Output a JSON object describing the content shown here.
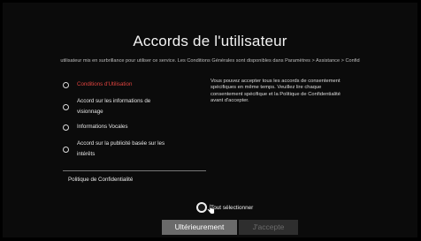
{
  "title": "Accords de l'utilisateur",
  "banner": "utilisateur mis en surbrillance pour utiliser ce service. Les Conditions Générales sont disponibles dans Paramètres > Assistance > Confid",
  "agreements": [
    {
      "lines": [
        "Conditions d'Utilisation"
      ],
      "active": true
    },
    {
      "lines": [
        "Accord sur les informations de",
        "visionnage"
      ],
      "active": false
    },
    {
      "lines": [
        "Informations Vocales"
      ],
      "active": false
    },
    {
      "lines": [
        "Accord sur la publicité basée sur les",
        "intérêts"
      ],
      "active": false
    }
  ],
  "policy_label": "Politique de Confidentialité",
  "description": "Vous pouvez accepter tous les accords de consentement spécifiques en même temps. Veuillez lire chaque consentement spécifique et la Politique de Confidentialité avant d'accepter.",
  "select_all_label": "Tout sélectionner",
  "buttons": {
    "later": "Ultérieurement",
    "accept": "J'accepte"
  },
  "colors": {
    "highlight": "#e1443f",
    "button_focused": "#6a6a6a",
    "button_disabled": "#2e2e2e"
  }
}
